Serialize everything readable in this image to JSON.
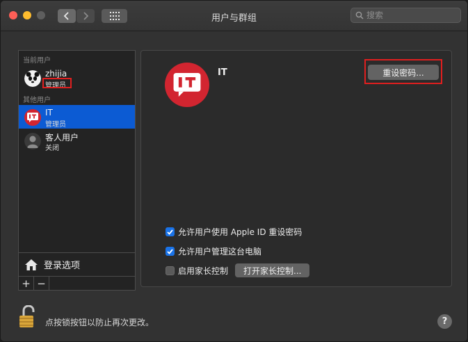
{
  "window": {
    "title": "用户与群组"
  },
  "search": {
    "placeholder": "搜索"
  },
  "sidebar": {
    "current_header": "当前用户",
    "other_header": "其他用户",
    "current_user": {
      "name": "zhijia",
      "role": "管理员"
    },
    "other_users": [
      {
        "name": "IT",
        "role": "管理员"
      },
      {
        "name": "客人用户",
        "role": "关闭"
      }
    ],
    "login_options": "登录选项",
    "add": "+",
    "remove": "−"
  },
  "main": {
    "user_name": "IT",
    "avatar_text": "IT",
    "reset_password": "重设密码...",
    "checkboxes": [
      {
        "label": "允许用户使用 Apple ID 重设密码",
        "checked": true
      },
      {
        "label": "允许用户管理这台电脑",
        "checked": true
      },
      {
        "label": "启用家长控制",
        "checked": false
      }
    ],
    "open_parental": "打开家长控制..."
  },
  "footer": {
    "lock_text": "点按锁按钮以防止再次更改。",
    "help": "?"
  },
  "colors": {
    "accent": "#0c5bd3",
    "brand_red": "#d22530",
    "highlight": "#e01f1f"
  }
}
